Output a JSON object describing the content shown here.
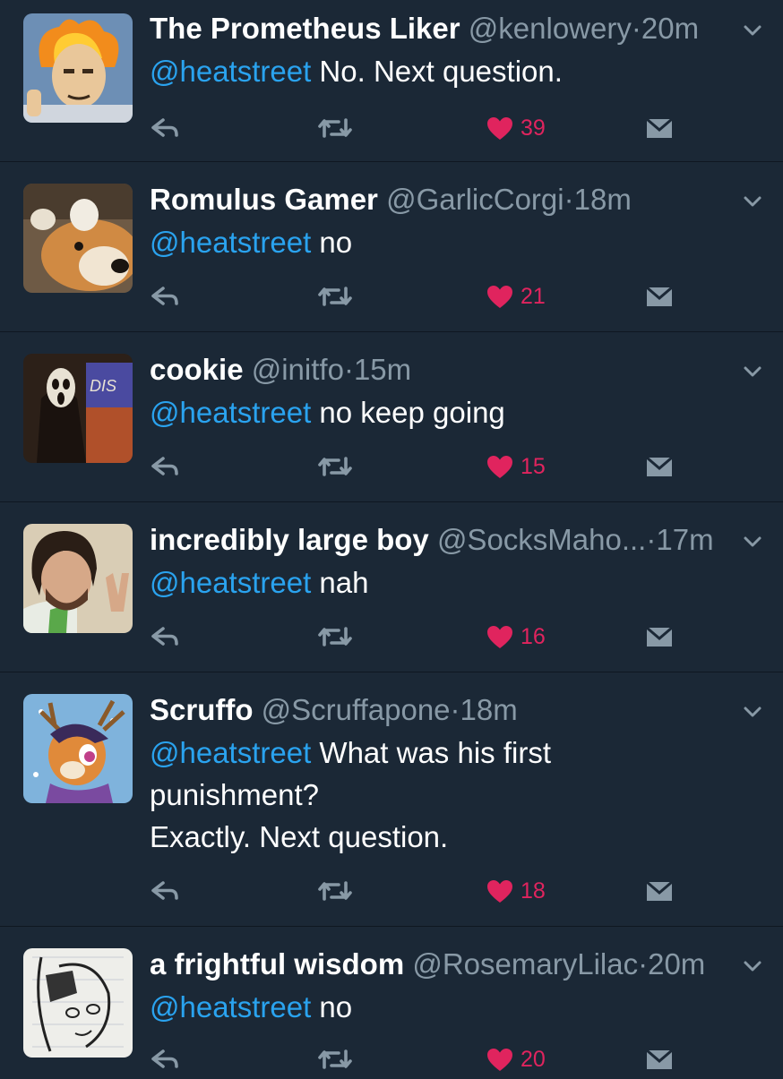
{
  "colors": {
    "background": "#1b2836",
    "mention": "#2aa3ef",
    "secondary_text": "#8899a6",
    "like": "#e0245e"
  },
  "icons": {
    "reply": "reply-icon",
    "retweet": "retweet-icon",
    "like": "heart-icon",
    "message": "message-icon",
    "more": "chevron-down-icon"
  },
  "tweets": [
    {
      "name": "The Prometheus Liker",
      "handle": "@kenlowery",
      "dot": "·",
      "time": "20m",
      "mention": "@heatstreet",
      "lines": [
        " No. Next question."
      ],
      "likes": "39"
    },
    {
      "name": "Romulus Gamer",
      "handle": "@GarlicCorgi",
      "dot": "·",
      "time": "18m",
      "mention": "@heatstreet",
      "lines": [
        " no"
      ],
      "likes": "21"
    },
    {
      "name": "cookie",
      "handle": "@initfo",
      "dot": "·",
      "time": "15m",
      "mention": "@heatstreet",
      "lines": [
        " no keep going"
      ],
      "likes": "15"
    },
    {
      "name": "incredibly large boy",
      "handle": "@SocksMaho...",
      "dot": "·",
      "time": "17m",
      "mention": "@heatstreet",
      "lines": [
        " nah"
      ],
      "likes": "16"
    },
    {
      "name": "Scruffo",
      "handle": "@Scruffapone",
      "dot": "·",
      "time": "18m",
      "mention": "@heatstreet",
      "lines": [
        " What was his first",
        "punishment?",
        "Exactly. Next question."
      ],
      "likes": "18"
    },
    {
      "name": "a frightful wisdom",
      "handle": "@RosemaryLilac",
      "dot": "·",
      "time": "20m",
      "mention": "@heatstreet",
      "lines": [
        " no"
      ],
      "likes": "20"
    }
  ]
}
